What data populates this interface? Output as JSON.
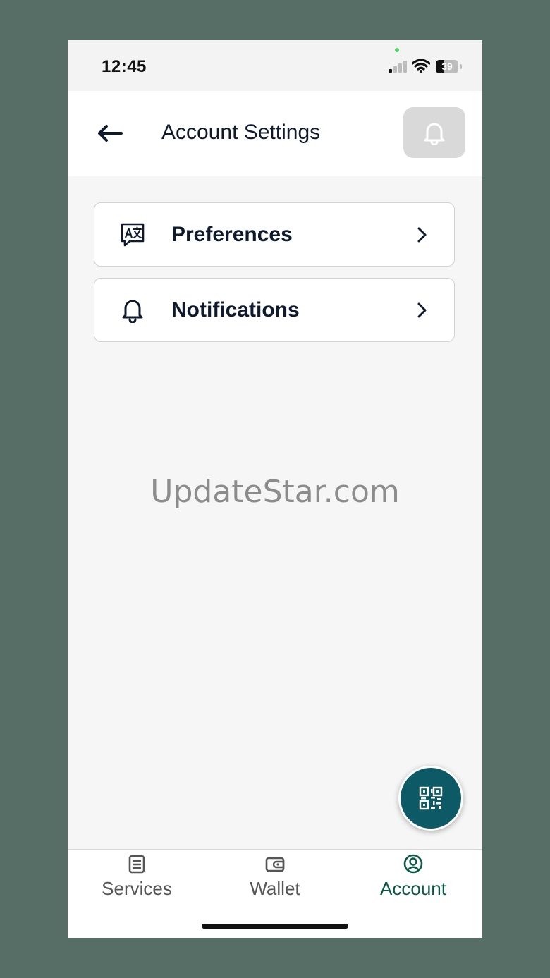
{
  "status_bar": {
    "time": "12:45",
    "battery_percent": "39",
    "signal_bars": 1,
    "wifi": "full"
  },
  "header": {
    "title": "Account Settings",
    "back_icon": "arrow-left-icon",
    "notification_icon": "bell-icon"
  },
  "menu": [
    {
      "label": "Preferences",
      "icon": "translate-icon"
    },
    {
      "label": "Notifications",
      "icon": "bell-icon"
    }
  ],
  "watermark": "UpdateStar.com",
  "fab": {
    "icon": "qr-code-icon"
  },
  "bottom_nav": {
    "items": [
      {
        "label": "Services",
        "icon": "clipboard-icon",
        "active": false
      },
      {
        "label": "Wallet",
        "icon": "wallet-icon",
        "active": false
      },
      {
        "label": "Account",
        "icon": "user-circle-icon",
        "active": true
      }
    ],
    "active_color": "#0b5a46",
    "inactive_color": "#555555"
  },
  "colors": {
    "accent": "#0d5a66",
    "title_text": "#0f1a2e",
    "background_frame": "#566e66"
  }
}
